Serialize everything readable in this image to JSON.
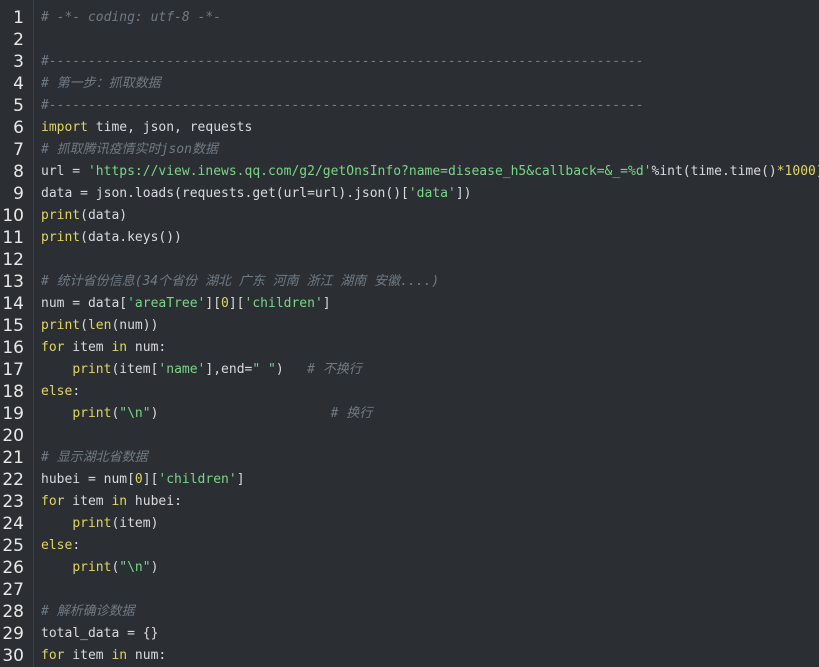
{
  "editor": {
    "lines": [
      {
        "n": "1",
        "tokens": [
          {
            "t": "comment",
            "v": "# -*- coding: utf-8 -*-"
          }
        ]
      },
      {
        "n": "2",
        "tokens": []
      },
      {
        "n": "3",
        "tokens": [
          {
            "t": "comment",
            "v": "#----------------------------------------------------------------------------"
          }
        ]
      },
      {
        "n": "4",
        "tokens": [
          {
            "t": "comment",
            "v": "# 第一步：抓取数据"
          }
        ]
      },
      {
        "n": "5",
        "tokens": [
          {
            "t": "comment",
            "v": "#----------------------------------------------------------------------------"
          }
        ]
      },
      {
        "n": "6",
        "tokens": [
          {
            "t": "keyword",
            "v": "import"
          },
          {
            "t": "plain",
            "v": " time, json, requests"
          }
        ]
      },
      {
        "n": "7",
        "tokens": [
          {
            "t": "comment",
            "v": "# 抓取腾讯疫情实时json数据"
          }
        ]
      },
      {
        "n": "8",
        "tokens": [
          {
            "t": "plain",
            "v": "url = "
          },
          {
            "t": "string",
            "v": "'https://view.inews.qq.com/g2/getOnsInfo?name=disease_h5&callback=&_=%d'"
          },
          {
            "t": "plain",
            "v": "%int(time.time()"
          },
          {
            "t": "number",
            "v": "*1000"
          },
          {
            "t": "plain",
            "v": ")"
          }
        ]
      },
      {
        "n": "9",
        "tokens": [
          {
            "t": "plain",
            "v": "data = json.loads(requests.get(url=url).json()["
          },
          {
            "t": "string",
            "v": "'data'"
          },
          {
            "t": "plain",
            "v": "])"
          }
        ]
      },
      {
        "n": "10",
        "tokens": [
          {
            "t": "func",
            "v": "print"
          },
          {
            "t": "plain",
            "v": "(data)"
          }
        ]
      },
      {
        "n": "11",
        "tokens": [
          {
            "t": "func",
            "v": "print"
          },
          {
            "t": "plain",
            "v": "(data.keys())"
          }
        ]
      },
      {
        "n": "12",
        "tokens": []
      },
      {
        "n": "13",
        "tokens": [
          {
            "t": "comment",
            "v": "# 统计省份信息(34个省份 湖北 广东 河南 浙江 湖南 安徽....)"
          }
        ]
      },
      {
        "n": "14",
        "tokens": [
          {
            "t": "plain",
            "v": "num = data["
          },
          {
            "t": "string",
            "v": "'areaTree'"
          },
          {
            "t": "plain",
            "v": "]["
          },
          {
            "t": "number",
            "v": "0"
          },
          {
            "t": "plain",
            "v": "]["
          },
          {
            "t": "string",
            "v": "'children'"
          },
          {
            "t": "plain",
            "v": "]"
          }
        ]
      },
      {
        "n": "15",
        "tokens": [
          {
            "t": "func",
            "v": "print"
          },
          {
            "t": "plain",
            "v": "("
          },
          {
            "t": "func",
            "v": "len"
          },
          {
            "t": "plain",
            "v": "(num))"
          }
        ]
      },
      {
        "n": "16",
        "tokens": [
          {
            "t": "keyword",
            "v": "for"
          },
          {
            "t": "plain",
            "v": " item "
          },
          {
            "t": "keyword",
            "v": "in"
          },
          {
            "t": "plain",
            "v": " num:"
          }
        ]
      },
      {
        "n": "17",
        "tokens": [
          {
            "t": "plain",
            "v": "    "
          },
          {
            "t": "func",
            "v": "print"
          },
          {
            "t": "plain",
            "v": "(item["
          },
          {
            "t": "string",
            "v": "'name'"
          },
          {
            "t": "plain",
            "v": "],end="
          },
          {
            "t": "string",
            "v": "\" \""
          },
          {
            "t": "plain",
            "v": ")   "
          },
          {
            "t": "comment",
            "v": "# 不换行"
          }
        ]
      },
      {
        "n": "18",
        "tokens": [
          {
            "t": "keyword",
            "v": "else"
          },
          {
            "t": "plain",
            "v": ":"
          }
        ]
      },
      {
        "n": "19",
        "tokens": [
          {
            "t": "plain",
            "v": "    "
          },
          {
            "t": "func",
            "v": "print"
          },
          {
            "t": "plain",
            "v": "("
          },
          {
            "t": "string",
            "v": "\"\\n\""
          },
          {
            "t": "plain",
            "v": ")                      "
          },
          {
            "t": "comment",
            "v": "# 换行"
          }
        ]
      },
      {
        "n": "20",
        "tokens": []
      },
      {
        "n": "21",
        "tokens": [
          {
            "t": "comment",
            "v": "# 显示湖北省数据"
          }
        ]
      },
      {
        "n": "22",
        "tokens": [
          {
            "t": "plain",
            "v": "hubei = num["
          },
          {
            "t": "number",
            "v": "0"
          },
          {
            "t": "plain",
            "v": "]["
          },
          {
            "t": "string",
            "v": "'children'"
          },
          {
            "t": "plain",
            "v": "]"
          }
        ]
      },
      {
        "n": "23",
        "tokens": [
          {
            "t": "keyword",
            "v": "for"
          },
          {
            "t": "plain",
            "v": " item "
          },
          {
            "t": "keyword",
            "v": "in"
          },
          {
            "t": "plain",
            "v": " hubei:"
          }
        ]
      },
      {
        "n": "24",
        "tokens": [
          {
            "t": "plain",
            "v": "    "
          },
          {
            "t": "func",
            "v": "print"
          },
          {
            "t": "plain",
            "v": "(item)"
          }
        ]
      },
      {
        "n": "25",
        "tokens": [
          {
            "t": "keyword",
            "v": "else"
          },
          {
            "t": "plain",
            "v": ":"
          }
        ]
      },
      {
        "n": "26",
        "tokens": [
          {
            "t": "plain",
            "v": "    "
          },
          {
            "t": "func",
            "v": "print"
          },
          {
            "t": "plain",
            "v": "("
          },
          {
            "t": "string",
            "v": "\"\\n\""
          },
          {
            "t": "plain",
            "v": ")"
          }
        ]
      },
      {
        "n": "27",
        "tokens": []
      },
      {
        "n": "28",
        "tokens": [
          {
            "t": "comment",
            "v": "# 解析确诊数据"
          }
        ]
      },
      {
        "n": "29",
        "tokens": [
          {
            "t": "plain",
            "v": "total_data = {}"
          }
        ]
      },
      {
        "n": "30",
        "tokens": [
          {
            "t": "keyword",
            "v": "for"
          },
          {
            "t": "plain",
            "v": " item "
          },
          {
            "t": "keyword",
            "v": "in"
          },
          {
            "t": "plain",
            "v": " num:"
          }
        ]
      }
    ]
  }
}
